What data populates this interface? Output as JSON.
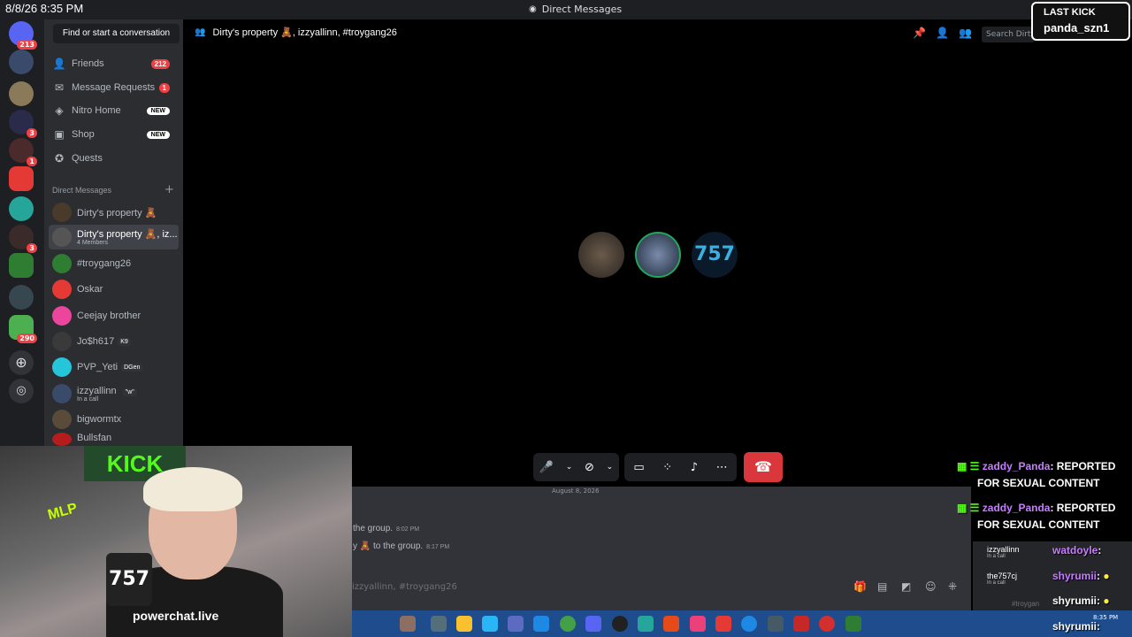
{
  "titlebar": {
    "clock": "8/8/26 8:35 PM",
    "title": "Direct Messages"
  },
  "servers": {
    "home_badge": "213",
    "badges": [
      "3",
      "1",
      "3",
      "290"
    ]
  },
  "sidebar": {
    "find": "Find or start a conversation",
    "nav": [
      {
        "label": "Friends",
        "pill": "212"
      },
      {
        "label": "Message Requests",
        "pill": "1"
      },
      {
        "label": "Nitro Home",
        "new": "NEW"
      },
      {
        "label": "Shop",
        "new": "NEW"
      },
      {
        "label": "Quests"
      }
    ],
    "dm_header": "Direct Messages",
    "dms": [
      {
        "name": "Dirty's property 🧸"
      },
      {
        "name": "Dirty's property 🧸, iz...",
        "sub": "4 Members"
      },
      {
        "name": "#troygang26"
      },
      {
        "name": "Oskar"
      },
      {
        "name": "Ceejay brother"
      },
      {
        "name": "Jo$h617",
        "tag": "K9"
      },
      {
        "name": "PVP_Yeti",
        "tag": "DGen"
      },
      {
        "name": "izzyallinn",
        "tag": "\"w\"",
        "sub": "In a call"
      },
      {
        "name": "bigwormtx"
      },
      {
        "name": "Bullsfan"
      }
    ]
  },
  "channel": {
    "header": "Dirty's property 🧸, izzyallinn, #troygang26",
    "search_placeholder": "Search Dirty's p"
  },
  "chat": {
    "date": "August 8, 2026",
    "messages": [
      {
        "text": "the group.",
        "time": "8:02 PM"
      },
      {
        "text": "y 🧸 to the group.",
        "time": "8:17 PM"
      }
    ],
    "input_placeholder": "izzyallinn, #troygang26"
  },
  "taskbar": {
    "time": "8:35 PM"
  },
  "overlay": {
    "last_kick_label": "LAST KICK",
    "last_kick_user": "panda_szn1",
    "stream_chat": [
      {
        "user": "zaddy_Panda",
        "text": ": REPORTED",
        "text2": "FOR SEXUAL CONTENT"
      },
      {
        "user": "zaddy_Panda",
        "text": ": REPORTED",
        "text2": "FOR SEXUAL CONTENT"
      },
      {
        "user": "watdoyle",
        "text": ":"
      },
      {
        "user": "shyrumii",
        "text": ":"
      },
      {
        "user": "shyrumii",
        "text": ":"
      },
      {
        "user": "shyrumii",
        "text": ":"
      }
    ],
    "call_users": [
      {
        "name": "izzyallinn",
        "sub": "In a call"
      },
      {
        "name": "the757cj",
        "sub": "In a call"
      }
    ],
    "faint": "#troygan"
  },
  "webcam": {
    "banner": "KICK",
    "mic": "757",
    "watermark": "powerchat.live",
    "sticker": "MLP"
  },
  "colors": {
    "rail": "#1e1f22",
    "sidebar": "#2b2d31",
    "hangup": "#da373c",
    "kick": "#53fc18"
  }
}
